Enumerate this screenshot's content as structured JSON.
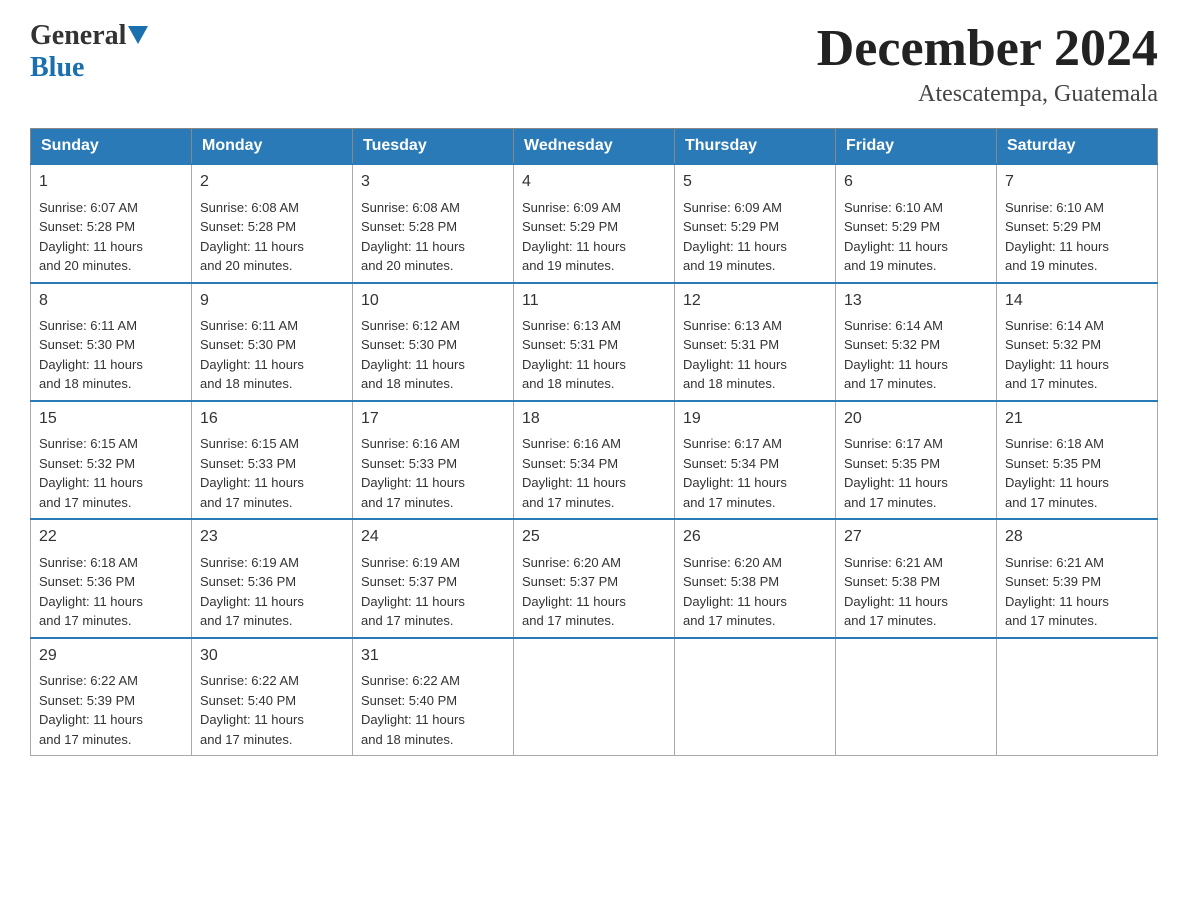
{
  "header": {
    "logo": {
      "general": "General",
      "blue": "Blue"
    },
    "title": "December 2024",
    "location": "Atescatempa, Guatemala"
  },
  "calendar": {
    "days_of_week": [
      "Sunday",
      "Monday",
      "Tuesday",
      "Wednesday",
      "Thursday",
      "Friday",
      "Saturday"
    ],
    "weeks": [
      [
        {
          "day": "1",
          "sunrise": "6:07 AM",
          "sunset": "5:28 PM",
          "daylight": "11 hours and 20 minutes."
        },
        {
          "day": "2",
          "sunrise": "6:08 AM",
          "sunset": "5:28 PM",
          "daylight": "11 hours and 20 minutes."
        },
        {
          "day": "3",
          "sunrise": "6:08 AM",
          "sunset": "5:28 PM",
          "daylight": "11 hours and 20 minutes."
        },
        {
          "day": "4",
          "sunrise": "6:09 AM",
          "sunset": "5:29 PM",
          "daylight": "11 hours and 19 minutes."
        },
        {
          "day": "5",
          "sunrise": "6:09 AM",
          "sunset": "5:29 PM",
          "daylight": "11 hours and 19 minutes."
        },
        {
          "day": "6",
          "sunrise": "6:10 AM",
          "sunset": "5:29 PM",
          "daylight": "11 hours and 19 minutes."
        },
        {
          "day": "7",
          "sunrise": "6:10 AM",
          "sunset": "5:29 PM",
          "daylight": "11 hours and 19 minutes."
        }
      ],
      [
        {
          "day": "8",
          "sunrise": "6:11 AM",
          "sunset": "5:30 PM",
          "daylight": "11 hours and 18 minutes."
        },
        {
          "day": "9",
          "sunrise": "6:11 AM",
          "sunset": "5:30 PM",
          "daylight": "11 hours and 18 minutes."
        },
        {
          "day": "10",
          "sunrise": "6:12 AM",
          "sunset": "5:30 PM",
          "daylight": "11 hours and 18 minutes."
        },
        {
          "day": "11",
          "sunrise": "6:13 AM",
          "sunset": "5:31 PM",
          "daylight": "11 hours and 18 minutes."
        },
        {
          "day": "12",
          "sunrise": "6:13 AM",
          "sunset": "5:31 PM",
          "daylight": "11 hours and 18 minutes."
        },
        {
          "day": "13",
          "sunrise": "6:14 AM",
          "sunset": "5:32 PM",
          "daylight": "11 hours and 17 minutes."
        },
        {
          "day": "14",
          "sunrise": "6:14 AM",
          "sunset": "5:32 PM",
          "daylight": "11 hours and 17 minutes."
        }
      ],
      [
        {
          "day": "15",
          "sunrise": "6:15 AM",
          "sunset": "5:32 PM",
          "daylight": "11 hours and 17 minutes."
        },
        {
          "day": "16",
          "sunrise": "6:15 AM",
          "sunset": "5:33 PM",
          "daylight": "11 hours and 17 minutes."
        },
        {
          "day": "17",
          "sunrise": "6:16 AM",
          "sunset": "5:33 PM",
          "daylight": "11 hours and 17 minutes."
        },
        {
          "day": "18",
          "sunrise": "6:16 AM",
          "sunset": "5:34 PM",
          "daylight": "11 hours and 17 minutes."
        },
        {
          "day": "19",
          "sunrise": "6:17 AM",
          "sunset": "5:34 PM",
          "daylight": "11 hours and 17 minutes."
        },
        {
          "day": "20",
          "sunrise": "6:17 AM",
          "sunset": "5:35 PM",
          "daylight": "11 hours and 17 minutes."
        },
        {
          "day": "21",
          "sunrise": "6:18 AM",
          "sunset": "5:35 PM",
          "daylight": "11 hours and 17 minutes."
        }
      ],
      [
        {
          "day": "22",
          "sunrise": "6:18 AM",
          "sunset": "5:36 PM",
          "daylight": "11 hours and 17 minutes."
        },
        {
          "day": "23",
          "sunrise": "6:19 AM",
          "sunset": "5:36 PM",
          "daylight": "11 hours and 17 minutes."
        },
        {
          "day": "24",
          "sunrise": "6:19 AM",
          "sunset": "5:37 PM",
          "daylight": "11 hours and 17 minutes."
        },
        {
          "day": "25",
          "sunrise": "6:20 AM",
          "sunset": "5:37 PM",
          "daylight": "11 hours and 17 minutes."
        },
        {
          "day": "26",
          "sunrise": "6:20 AM",
          "sunset": "5:38 PM",
          "daylight": "11 hours and 17 minutes."
        },
        {
          "day": "27",
          "sunrise": "6:21 AM",
          "sunset": "5:38 PM",
          "daylight": "11 hours and 17 minutes."
        },
        {
          "day": "28",
          "sunrise": "6:21 AM",
          "sunset": "5:39 PM",
          "daylight": "11 hours and 17 minutes."
        }
      ],
      [
        {
          "day": "29",
          "sunrise": "6:22 AM",
          "sunset": "5:39 PM",
          "daylight": "11 hours and 17 minutes."
        },
        {
          "day": "30",
          "sunrise": "6:22 AM",
          "sunset": "5:40 PM",
          "daylight": "11 hours and 17 minutes."
        },
        {
          "day": "31",
          "sunrise": "6:22 AM",
          "sunset": "5:40 PM",
          "daylight": "11 hours and 18 minutes."
        },
        null,
        null,
        null,
        null
      ]
    ],
    "labels": {
      "sunrise": "Sunrise:",
      "sunset": "Sunset:",
      "daylight": "Daylight:"
    }
  }
}
